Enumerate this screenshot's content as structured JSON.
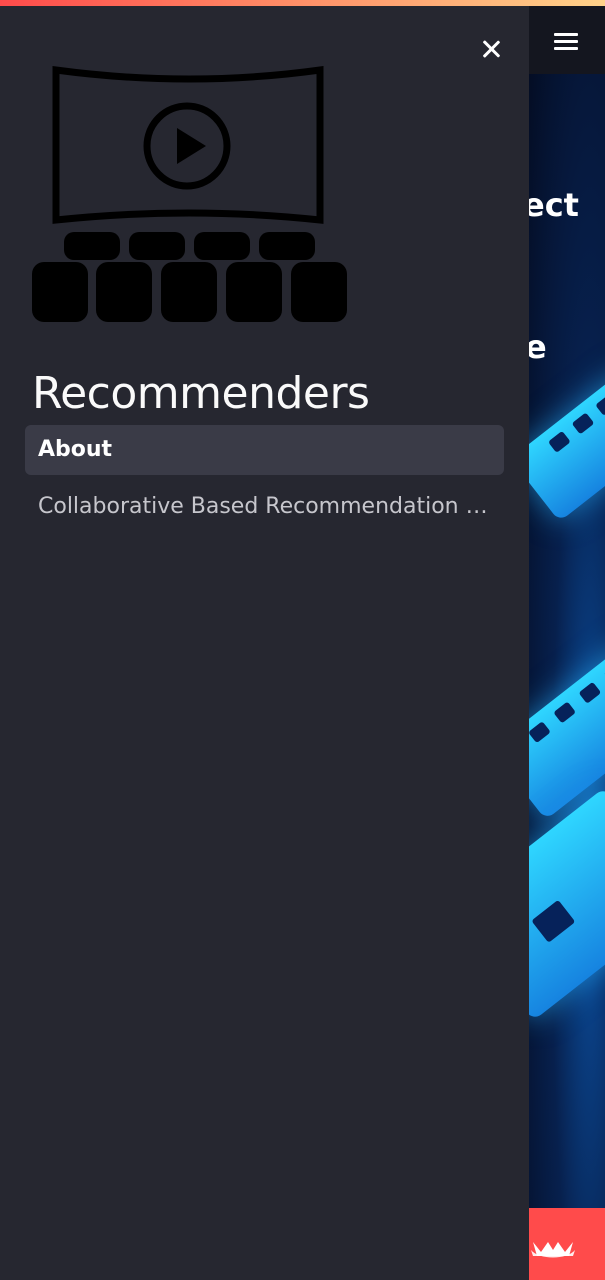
{
  "sidebar": {
    "title": "Recommenders",
    "logo_icon": "cinema-screen-icon",
    "close_icon": "close-icon",
    "nav_items": [
      {
        "label": "About",
        "active": true
      },
      {
        "label": "Collaborative Based Recommendation System",
        "active": false
      }
    ]
  },
  "main": {
    "menu_icon": "hamburger-menu-icon",
    "banner_text_1": "ect",
    "banner_text_2": "e"
  },
  "badge": {
    "icon": "crown-icon",
    "color": "#ff4b4b"
  },
  "colors": {
    "sidebar_bg": "#262730",
    "active_item_bg": "#3a3b47",
    "accent": "#ff4b4b",
    "main_bg": "#0e1117"
  }
}
